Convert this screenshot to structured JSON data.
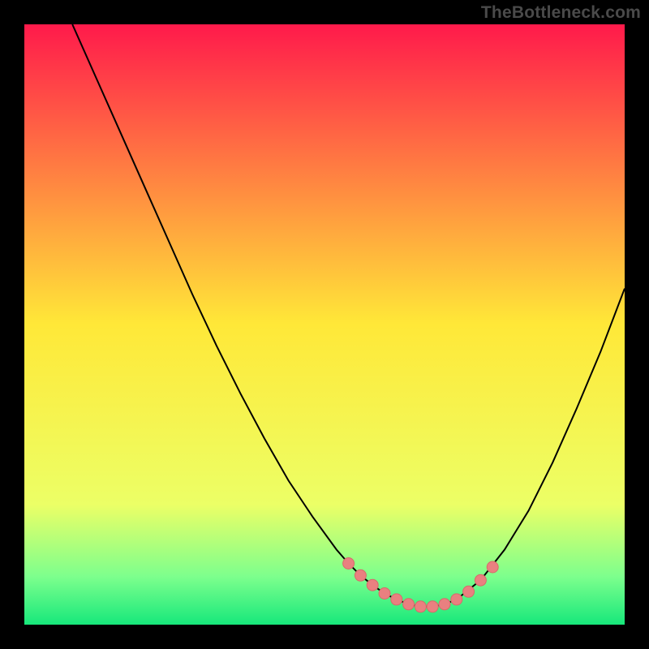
{
  "watermark": "TheBottleneck.com",
  "colors": {
    "bg": "#000000",
    "grad_top": "#ff1a4b",
    "grad_mid": "#ffe838",
    "grad_bottom1": "#ecff66",
    "grad_bottom2": "#7dff8d",
    "grad_bottom3": "#17e87b",
    "curve": "#000000",
    "marker_fill": "#e98080",
    "marker_stroke": "#d86a6a"
  },
  "chart_data": {
    "type": "line",
    "title": "",
    "xlabel": "",
    "ylabel": "",
    "xlim": [
      0,
      100
    ],
    "ylim": [
      0,
      100
    ],
    "curve_x": [
      8,
      12,
      16,
      20,
      24,
      28,
      32,
      36,
      40,
      44,
      48,
      52,
      54,
      56,
      58,
      60,
      62,
      64,
      66,
      68,
      70,
      72,
      76,
      80,
      84,
      88,
      92,
      96,
      100
    ],
    "curve_y_pct": [
      100,
      91,
      82,
      73,
      64,
      55,
      46.5,
      38.5,
      31,
      24,
      18,
      12.5,
      10.2,
      8.2,
      6.6,
      5.2,
      4.2,
      3.4,
      3,
      3,
      3.4,
      4.2,
      7.4,
      12.5,
      19,
      27,
      36,
      45.5,
      56
    ],
    "markers_x": [
      54,
      56,
      58,
      60,
      62,
      64,
      66,
      68,
      70,
      72,
      74,
      76,
      78
    ],
    "markers_y_pct": [
      10.2,
      8.2,
      6.6,
      5.2,
      4.2,
      3.4,
      3,
      3,
      3.4,
      4.2,
      5.5,
      7.4,
      9.6
    ]
  }
}
